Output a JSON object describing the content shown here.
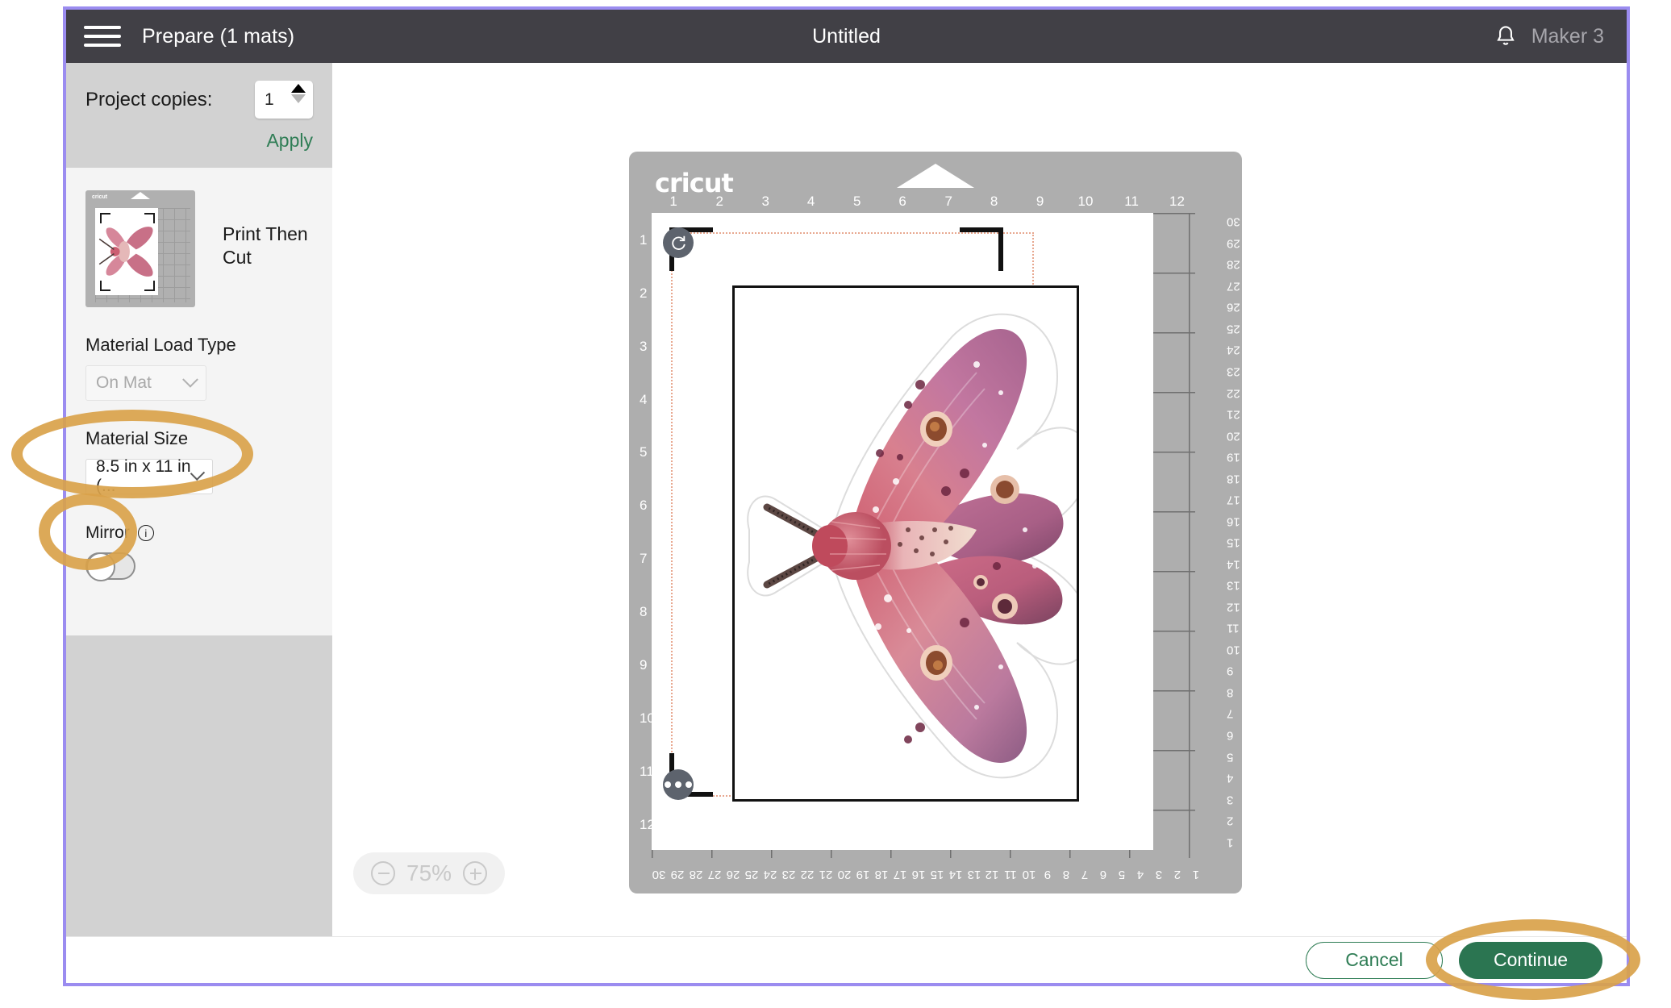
{
  "app": {
    "menu_icon": "hamburger-icon",
    "title": "Prepare (1 mats)",
    "document_title": "Untitled",
    "bell_icon": "bell-icon",
    "device": "Maker 3"
  },
  "sidebar": {
    "copies_label": "Project copies:",
    "copies_value": "1",
    "apply_label": "Apply",
    "operation_label": "Print Then Cut",
    "material_load_type_label": "Material Load Type",
    "material_load_type_value": "On Mat",
    "material_size_label": "Material Size",
    "material_size_value": "8.5 in x 11 in (...",
    "mirror_label": "Mirror",
    "mirror_info_icon": "info-icon",
    "mirror_state": "off"
  },
  "mat": {
    "brand": "cricut",
    "rotate_icon": "rotate-icon",
    "more_icon": "more-options-icon",
    "ruler_inches": [
      "1",
      "2",
      "3",
      "4",
      "5",
      "6",
      "7",
      "8",
      "9",
      "10",
      "11",
      "12"
    ],
    "ruler_cm": [
      "1",
      "2",
      "3",
      "4",
      "5",
      "6",
      "7",
      "8",
      "9",
      "10",
      "11",
      "12",
      "13",
      "14",
      "15",
      "16",
      "17",
      "18",
      "19",
      "20",
      "21",
      "22",
      "23",
      "24",
      "25",
      "26",
      "27",
      "28",
      "29",
      "30"
    ],
    "artwork": "watercolor-pink-moth"
  },
  "zoom": {
    "minus_icon": "zoom-out-icon",
    "level": "75%",
    "plus_icon": "zoom-in-icon"
  },
  "footer": {
    "cancel_label": "Cancel",
    "continue_label": "Continue"
  },
  "colors": {
    "frame_purple": "#9b8cf0",
    "topbar": "#414046",
    "accent_green": "#2b7551",
    "annotation": "#d9a24a",
    "mat_gray": "#aeaeae"
  }
}
